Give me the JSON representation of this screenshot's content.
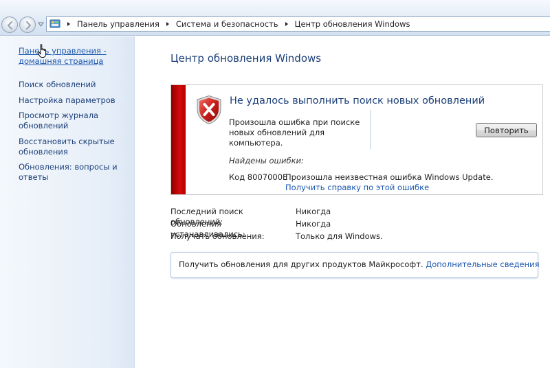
{
  "breadcrumb": [
    "Панель управления",
    "Система и безопасность",
    "Центр обновления Windows"
  ],
  "sidebar": {
    "home_link": "Панель управления - домашняя страница",
    "items": [
      {
        "label": "Поиск обновлений"
      },
      {
        "label": "Настройка параметров"
      },
      {
        "label": "Просмотр журнала обновлений"
      },
      {
        "label": "Восстановить скрытые обновления"
      },
      {
        "label": "Обновления: вопросы и ответы"
      }
    ]
  },
  "main": {
    "title": "Центр обновления Windows",
    "error": {
      "heading": "Не удалось выполнить поиск новых обновлений",
      "description": "Произошла ошибка при поиске новых обновлений для компьютера.",
      "retry_label": "Повторить",
      "found_label": "Найдены ошибки:",
      "code": "Код 8007000E",
      "message": "Произошла неизвестная ошибка Windows Update.",
      "help_link": "Получить справку по этой ошибке"
    },
    "status": [
      {
        "key": "Последний поиск обновлений:",
        "value": "Никогда"
      },
      {
        "key": "Обновления устанавливались:",
        "value": "Никогда"
      },
      {
        "key": "Получать обновления:",
        "value": "Только для Windows."
      }
    ],
    "info": {
      "text": "Получить обновления для других продуктов Майкрософт.",
      "link": "Дополнительные сведения"
    }
  },
  "colors": {
    "error_stripe": "#c80000",
    "link": "#1a56ae",
    "heading": "#1b3f78"
  }
}
